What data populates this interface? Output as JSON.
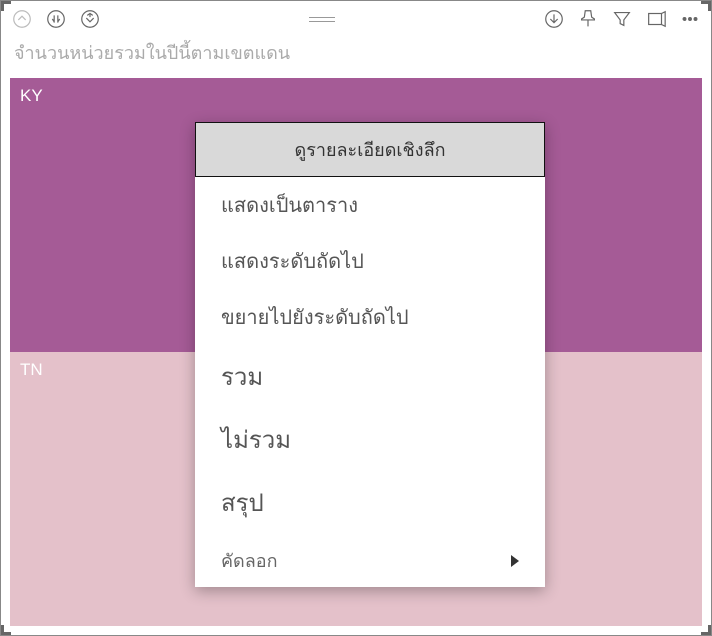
{
  "title": "จำนวนหน่วยรวมในปีนี้ตามเขตแดน",
  "treemap": {
    "tiles": [
      {
        "label": "KY",
        "color": "#a55b96"
      },
      {
        "label": "TN",
        "color": "#e4c1ca"
      }
    ]
  },
  "context_menu": {
    "header": "ดูรายละเอียดเชิงลึก",
    "items": [
      {
        "label": "แสดงเป็นตาราง"
      },
      {
        "label": "แสดงระดับถัดไป"
      },
      {
        "label": "ขยายไปยังระดับถัดไป"
      },
      {
        "label": "รวม",
        "large": true
      },
      {
        "label": "ไม่รวม",
        "large": true
      },
      {
        "label": "สรุป",
        "large": true
      },
      {
        "label": "คัดลอก",
        "submenu": true
      }
    ]
  },
  "toolbar_icons": {
    "drill_up": "drill-up",
    "drill_down": "drill-down",
    "drill_hierarchy": "drill-hierarchy",
    "expand_down": "expand-down",
    "pin": "pin",
    "filter": "filter",
    "focus": "focus",
    "more": "more"
  }
}
